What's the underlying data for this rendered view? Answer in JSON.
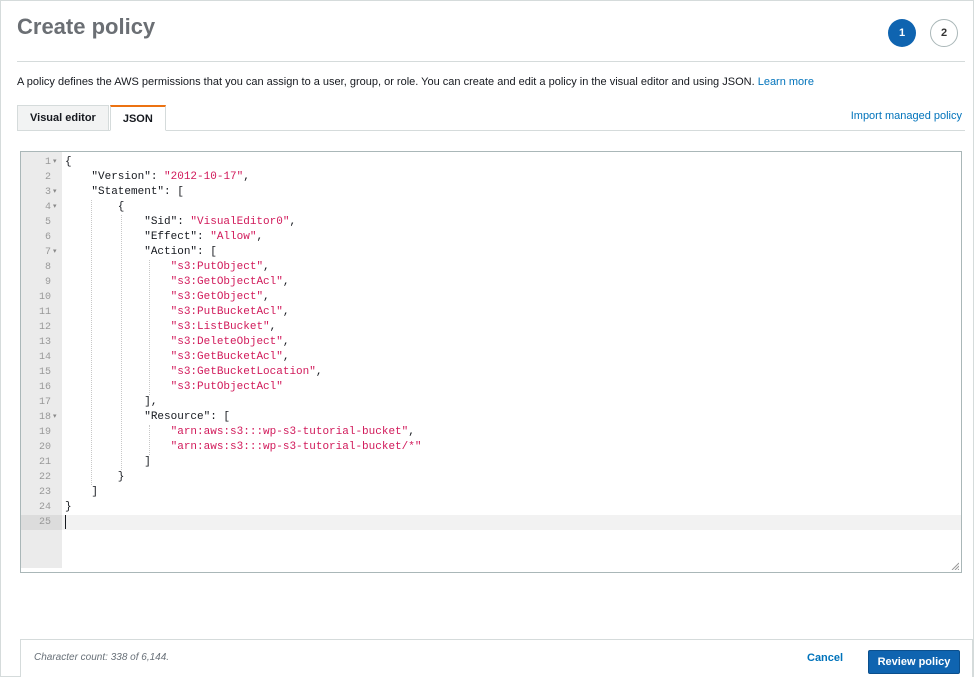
{
  "header": {
    "title": "Create policy",
    "steps": [
      "1",
      "2"
    ],
    "active_step": "1"
  },
  "description": {
    "text": "A policy defines the AWS permissions that you can assign to a user, group, or role. You can create and edit a policy in the visual editor and using JSON.",
    "learn_more": "Learn more"
  },
  "tabs": [
    {
      "label": "Visual editor",
      "active": false
    },
    {
      "label": "JSON",
      "active": true
    }
  ],
  "import_link": "Import managed policy",
  "editor": {
    "current_line": 25,
    "lines": [
      [
        {
          "t": "{"
        }
      ],
      [
        {
          "t": "    \"Version\": "
        },
        {
          "t": "\"2012-10-17\"",
          "s": true
        },
        {
          "t": ","
        }
      ],
      [
        {
          "t": "    \"Statement\": ["
        }
      ],
      [
        {
          "t": "        {"
        }
      ],
      [
        {
          "t": "            \"Sid\": "
        },
        {
          "t": "\"VisualEditor0\"",
          "s": true
        },
        {
          "t": ","
        }
      ],
      [
        {
          "t": "            \"Effect\": "
        },
        {
          "t": "\"Allow\"",
          "s": true
        },
        {
          "t": ","
        }
      ],
      [
        {
          "t": "            \"Action\": ["
        }
      ],
      [
        {
          "t": "                "
        },
        {
          "t": "\"s3:PutObject\"",
          "s": true
        },
        {
          "t": ","
        }
      ],
      [
        {
          "t": "                "
        },
        {
          "t": "\"s3:GetObjectAcl\"",
          "s": true
        },
        {
          "t": ","
        }
      ],
      [
        {
          "t": "                "
        },
        {
          "t": "\"s3:GetObject\"",
          "s": true
        },
        {
          "t": ","
        }
      ],
      [
        {
          "t": "                "
        },
        {
          "t": "\"s3:PutBucketAcl\"",
          "s": true
        },
        {
          "t": ","
        }
      ],
      [
        {
          "t": "                "
        },
        {
          "t": "\"s3:ListBucket\"",
          "s": true
        },
        {
          "t": ","
        }
      ],
      [
        {
          "t": "                "
        },
        {
          "t": "\"s3:DeleteObject\"",
          "s": true
        },
        {
          "t": ","
        }
      ],
      [
        {
          "t": "                "
        },
        {
          "t": "\"s3:GetBucketAcl\"",
          "s": true
        },
        {
          "t": ","
        }
      ],
      [
        {
          "t": "                "
        },
        {
          "t": "\"s3:GetBucketLocation\"",
          "s": true
        },
        {
          "t": ","
        }
      ],
      [
        {
          "t": "                "
        },
        {
          "t": "\"s3:PutObjectAcl\"",
          "s": true
        }
      ],
      [
        {
          "t": "            ],"
        }
      ],
      [
        {
          "t": "            \"Resource\": ["
        }
      ],
      [
        {
          "t": "                "
        },
        {
          "t": "\"arn:aws:s3:::wp-s3-tutorial-bucket\"",
          "s": true
        },
        {
          "t": ","
        }
      ],
      [
        {
          "t": "                "
        },
        {
          "t": "\"arn:aws:s3:::wp-s3-tutorial-bucket/*\"",
          "s": true
        }
      ],
      [
        {
          "t": "            ]"
        }
      ],
      [
        {
          "t": "        }"
        }
      ],
      [
        {
          "t": "    ]"
        }
      ],
      [
        {
          "t": "}"
        }
      ],
      [
        {
          "t": ""
        }
      ]
    ],
    "foldable_lines": [
      1,
      3,
      4,
      7,
      18
    ]
  },
  "footer": {
    "char_count": "Character count: 338 of 6,144.",
    "cancel_label": "Cancel",
    "review_label": "Review policy"
  },
  "colors": {
    "primary": "#0f64b0",
    "link": "#0073bb",
    "string": "#d1195a",
    "tab_accent": "#ec7211"
  }
}
